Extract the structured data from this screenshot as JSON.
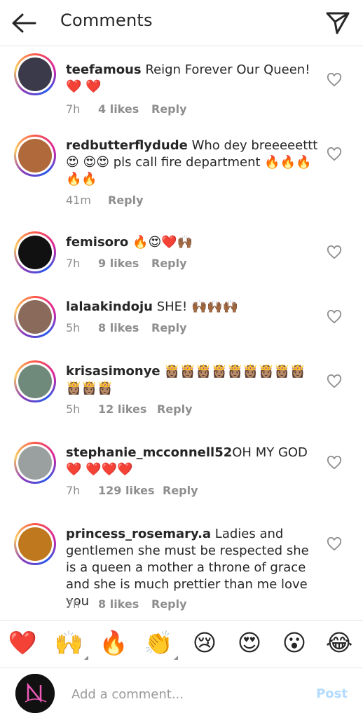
{
  "header": {
    "title": "Comments",
    "back_icon": "arrow-left-icon",
    "send_icon": "paper-plane-icon"
  },
  "comments": [
    {
      "user": "teefamous",
      "text": "Reign Forever Our Queen! ❤️ ❤️",
      "time": "7h",
      "likes": "4 likes",
      "reply": "Reply",
      "avatar_color": "#3a3a4a"
    },
    {
      "user": "redbutterflydude",
      "text": "Who dey breeeeettt 😍 😍😍 pls call fire department 🔥🔥🔥 🔥🔥",
      "time": "41m",
      "likes": "",
      "reply": "Reply",
      "avatar_color": "#b0693a"
    },
    {
      "user": "femisoro",
      "text": "🔥😍❤️🙌🏾",
      "time": "7h",
      "likes": "9 likes",
      "reply": "Reply",
      "avatar_color": "#111111"
    },
    {
      "user": "lalaakindoju",
      "text": "SHE! 🙌🏾🙌🏾🙌🏾",
      "time": "5h",
      "likes": "8 likes",
      "reply": "Reply",
      "avatar_color": "#8a6a5a"
    },
    {
      "user": "krisasimonye",
      "text": "👸🏽👸🏽👸🏽👸🏽👸🏽👸🏽👸🏽👸🏽👸🏽 👸🏽👸🏽👸🏽",
      "time": "5h",
      "likes": "12 likes",
      "reply": "Reply",
      "avatar_color": "#6f8a7a"
    },
    {
      "user": "stephanie_mcconnell52",
      "text": "OH MY GOD❤️ ❤️❤️❤️",
      "time": "7h",
      "likes": "129 likes",
      "reply": "Reply",
      "avatar_color": "#9aa0a0"
    },
    {
      "user": "princess_rosemary.a",
      "text": "Ladies and gentlemen she must be respected she is a queen a mother a throne of grace and she is much prettier than me love you",
      "time": "7h",
      "likes": "8 likes",
      "reply": "Reply",
      "avatar_color": "#c0781e"
    }
  ],
  "reactions": [
    {
      "emoji": "❤️",
      "more": false
    },
    {
      "emoji": "🙌",
      "more": true
    },
    {
      "emoji": "🔥",
      "more": false
    },
    {
      "emoji": "👏",
      "more": true
    },
    {
      "emoji": "😢",
      "more": false
    },
    {
      "emoji": "😍",
      "more": false
    },
    {
      "emoji": "😮",
      "more": false
    },
    {
      "emoji": "😂",
      "more": false
    }
  ],
  "composer": {
    "placeholder": "Add a comment...",
    "post_label": "Post",
    "post_color": "#b3dbff"
  }
}
